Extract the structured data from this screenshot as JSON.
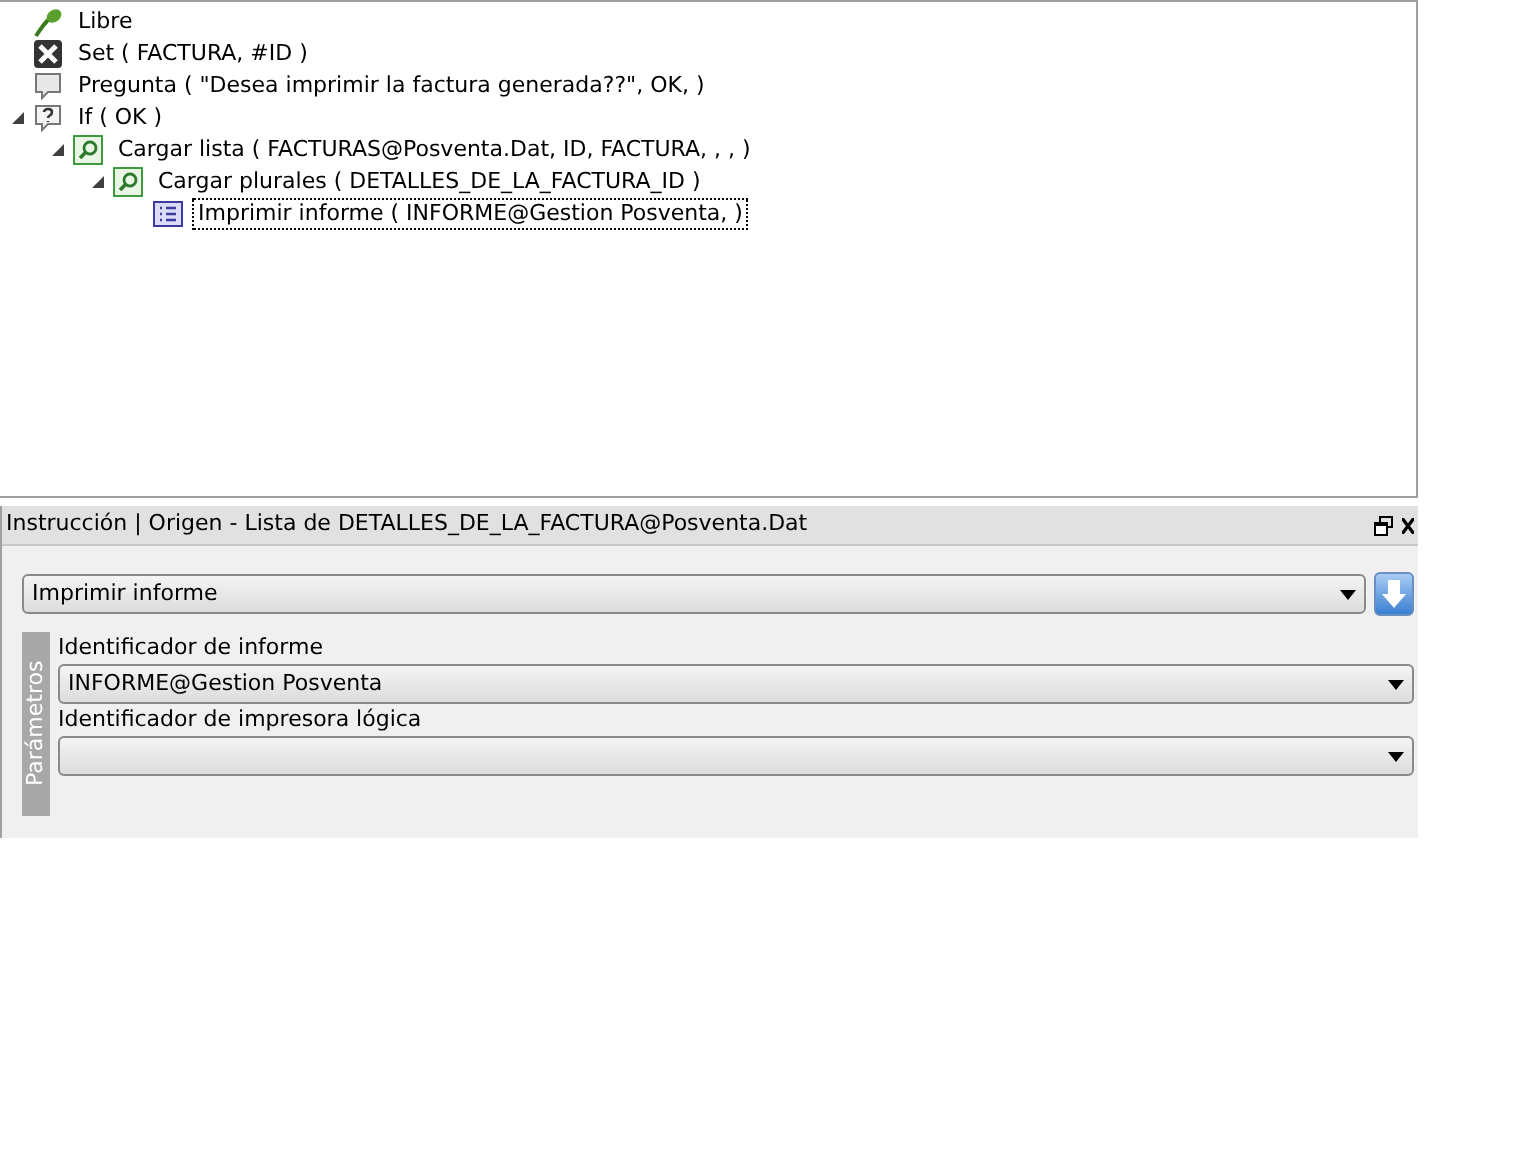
{
  "tree": [
    {
      "label": "Libre",
      "kind": "free",
      "selected": false
    },
    {
      "label": "Set ( FACTURA, #ID )",
      "kind": "set",
      "selected": false
    },
    {
      "label": "Pregunta ( \"Desea imprimir la factura generada??\", OK,  )",
      "kind": "ask",
      "selected": false
    },
    {
      "label": "If ( OK )",
      "kind": "if",
      "selected": false,
      "expanded": true,
      "children": [
        {
          "label": "Cargar lista ( FACTURAS@Posventa.Dat, ID, FACTURA, , ,  )",
          "kind": "load",
          "selected": false,
          "expanded": true,
          "children": [
            {
              "label": "Cargar plurales ( DETALLES_DE_LA_FACTURA_ID )",
              "kind": "load",
              "selected": false,
              "expanded": true,
              "children": [
                {
                  "label": "Imprimir informe ( INFORME@Gestion Posventa,  )",
                  "kind": "print",
                  "selected": true
                }
              ]
            }
          ]
        }
      ]
    }
  ],
  "panel": {
    "title": "Instrucción | Origen - Lista de DETALLES_DE_LA_FACTURA@Posventa.Dat",
    "instruction": {
      "value": "Imprimir informe"
    },
    "group_label": "Parámetros",
    "params": [
      {
        "label": "Identificador de informe",
        "value": "INFORME@Gestion Posventa"
      },
      {
        "label": "Identificador de impresora lógica"
      }
    ]
  }
}
